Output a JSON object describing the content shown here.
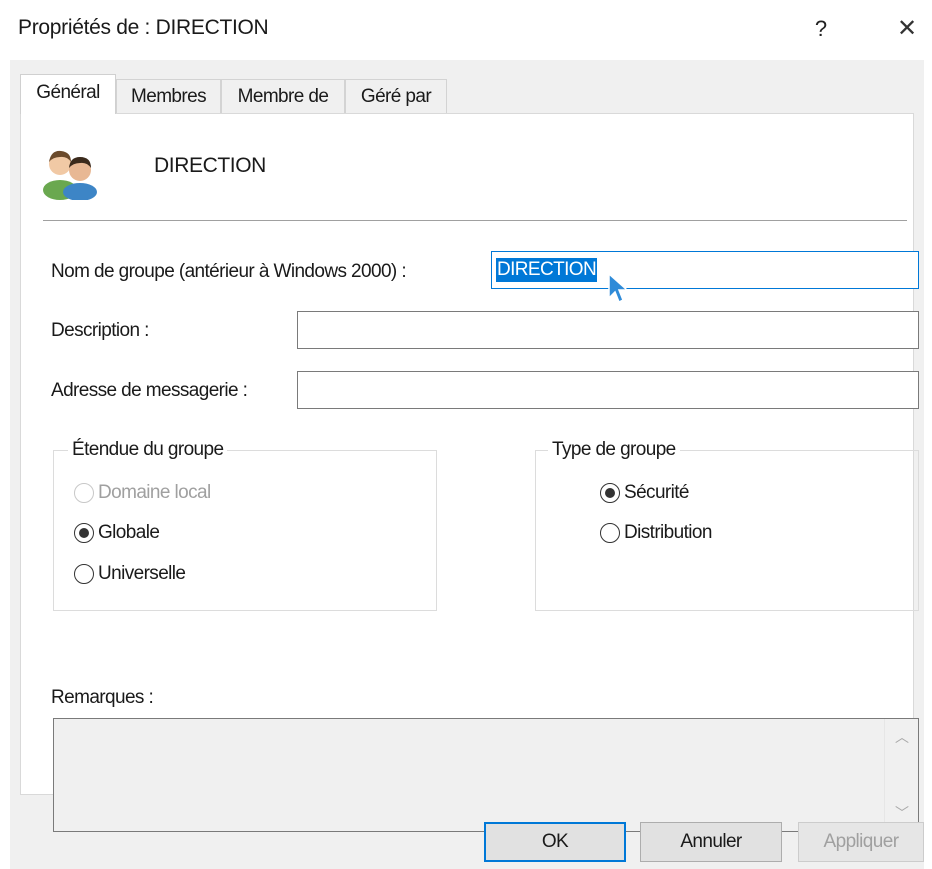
{
  "window": {
    "title": "Propriétés de : DIRECTION",
    "help_label": "?",
    "close_label": "✕"
  },
  "tabs": [
    {
      "label": "Général",
      "active": true
    },
    {
      "label": "Membres",
      "active": false
    },
    {
      "label": "Membre de",
      "active": false
    },
    {
      "label": "Géré par",
      "active": false
    }
  ],
  "group": {
    "icon": "group-users-icon",
    "name": "DIRECTION"
  },
  "fields": {
    "group_name_label": "Nom de groupe (antérieur à Windows 2000) :",
    "group_name_value": "DIRECTION",
    "description_label": "Description :",
    "description_value": "",
    "email_label": "Adresse de messagerie :",
    "email_value": ""
  },
  "scope": {
    "legend": "Étendue du groupe",
    "options": [
      {
        "label": "Domaine local",
        "checked": false,
        "disabled": true
      },
      {
        "label": "Globale",
        "checked": true,
        "disabled": false
      },
      {
        "label": "Universelle",
        "checked": false,
        "disabled": false
      }
    ]
  },
  "type": {
    "legend": "Type de groupe",
    "options": [
      {
        "label": "Sécurité",
        "checked": true
      },
      {
        "label": "Distribution",
        "checked": false
      }
    ]
  },
  "remarks": {
    "label": "Remarques :",
    "value": ""
  },
  "buttons": {
    "ok": "OK",
    "cancel": "Annuler",
    "apply": "Appliquer"
  },
  "colors": {
    "accent": "#0078d7",
    "dialog_bg": "#f0f0f0",
    "panel_bg": "#ffffff",
    "disabled_text": "#a0a0a0"
  }
}
